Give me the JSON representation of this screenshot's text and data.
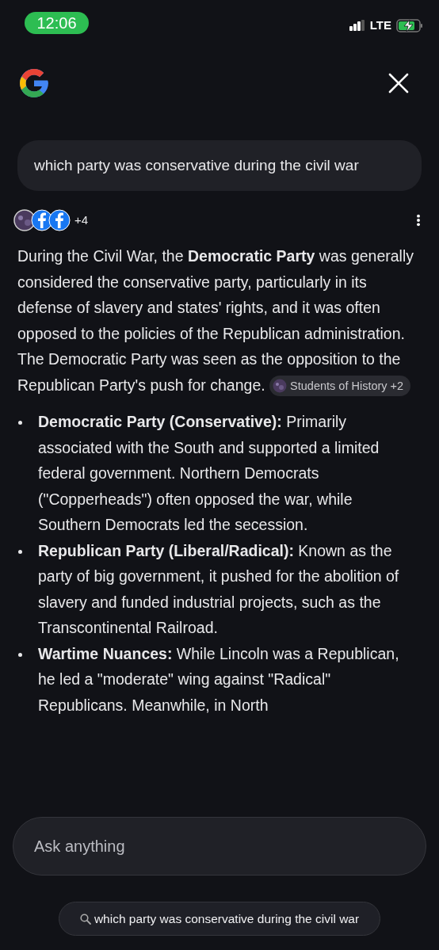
{
  "status_bar": {
    "time": "12:06",
    "network": "LTE"
  },
  "query": "which party was conservative during the civil war",
  "sources": {
    "more": "+4"
  },
  "answer": {
    "paragraph": "During the Civil War, the **Democratic Party** was generally considered the conservative party, particularly in its defense of slavery and states' rights, and it was often opposed to the policies of the Republican administration. The Democratic Party was seen as the opposition to the Republican Party's push for change.",
    "citation": "Students of History +2",
    "bullets": [
      {
        "text": "**Democratic Party (Conservative):** Primarily associated with the South and supported a limited federal government. Northern Democrats (\"Copperheads\") often opposed the war, while Southern Democrats led the secession."
      },
      {
        "text": "**Republican Party (Liberal/Radical):** Known as the party of big government, it pushed for the abolition of slavery and funded industrial projects, such as the Transcontinental Railroad."
      },
      {
        "text": "**Wartime Nuances:** While Lincoln was a Republican, he led a \"moderate\" wing against \"Radical\" Republicans. Meanwhile, in North"
      }
    ]
  },
  "ask_field": {
    "placeholder": "Ask anything"
  },
  "search_chip": "which party was conservative during the civil war"
}
